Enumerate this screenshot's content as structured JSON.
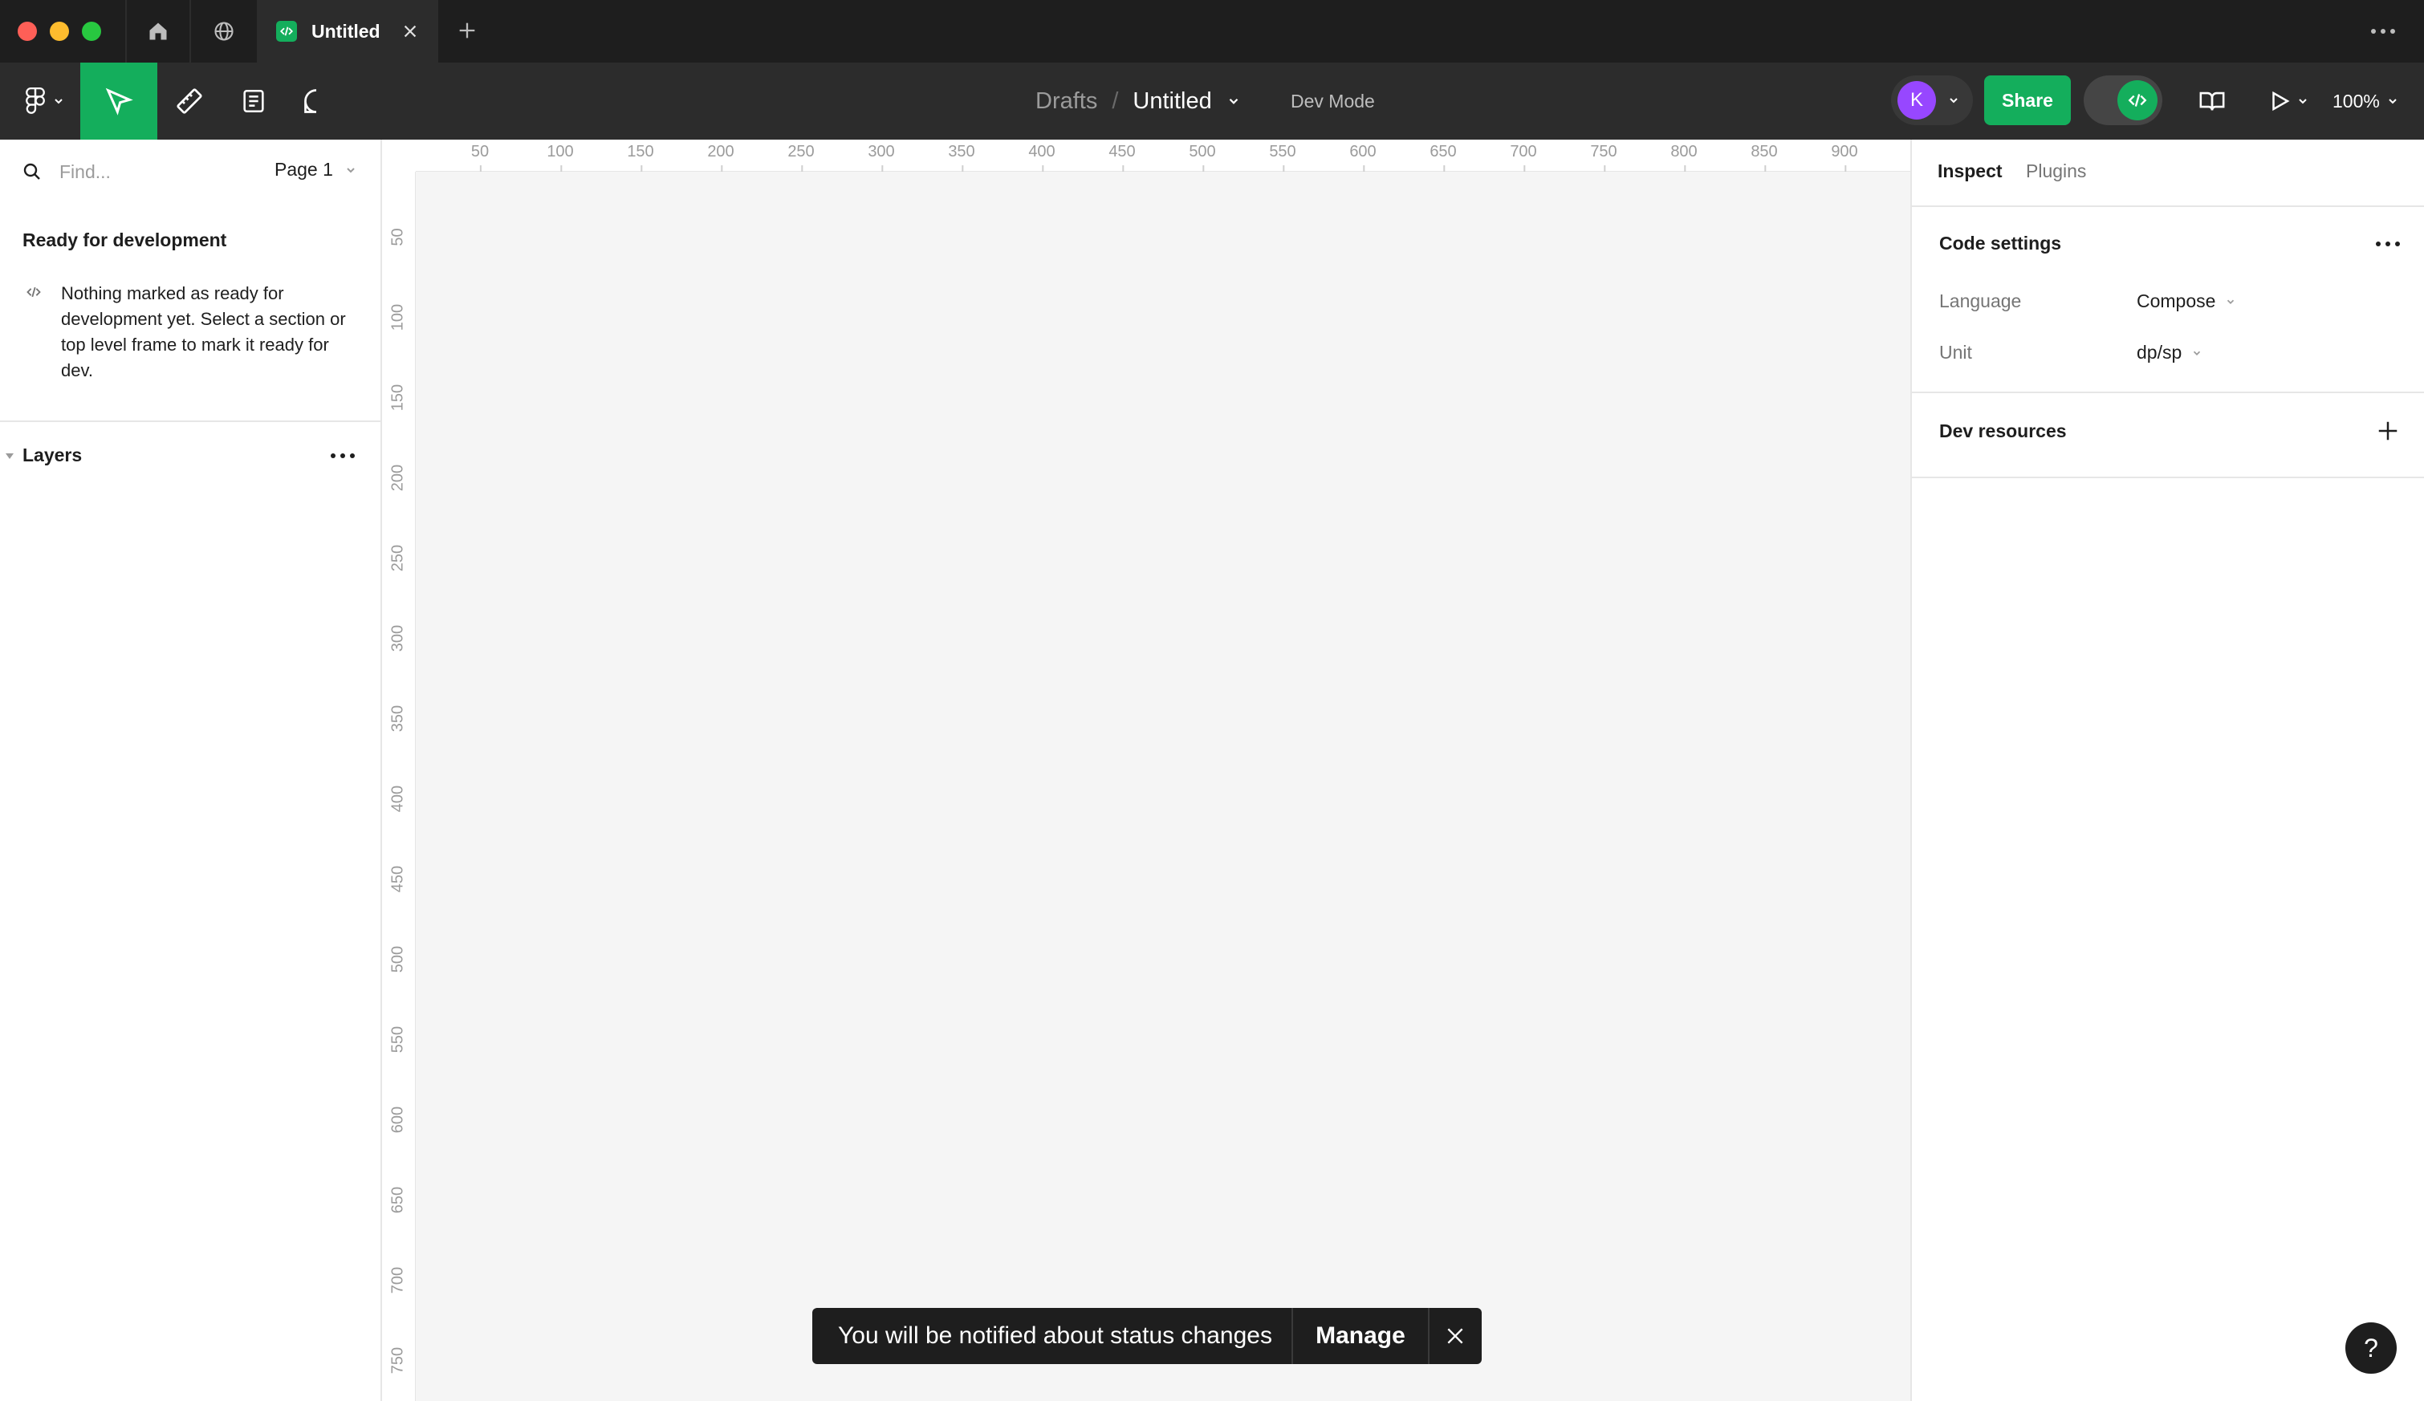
{
  "titlebar": {
    "doc_tab_label": "Untitled"
  },
  "toolbar": {
    "breadcrumb_root": "Drafts",
    "breadcrumb_sep": "/",
    "file_title": "Untitled",
    "mode_label": "Dev Mode",
    "avatar_initial": "K",
    "share_label": "Share",
    "zoom_label": "100%"
  },
  "left_panel": {
    "find_placeholder": "Find...",
    "page_label": "Page 1",
    "ready_title": "Ready for development",
    "ready_message": "Nothing marked as ready for development yet. Select a section or top level frame to mark it ready for dev.",
    "layers_label": "Layers"
  },
  "rulers": {
    "top": [
      "50",
      "100",
      "150",
      "200",
      "250",
      "300",
      "350",
      "400",
      "450",
      "500",
      "550",
      "600",
      "650",
      "700",
      "750",
      "800",
      "850",
      "900"
    ],
    "left": [
      "50",
      "100",
      "150",
      "200",
      "250",
      "300",
      "350",
      "400",
      "450",
      "500",
      "550",
      "600",
      "650",
      "700",
      "750"
    ]
  },
  "right_panel": {
    "tabs": [
      "Inspect",
      "Plugins"
    ],
    "code_settings_title": "Code settings",
    "language_label": "Language",
    "language_value": "Compose",
    "unit_label": "Unit",
    "unit_value": "dp/sp",
    "dev_resources_title": "Dev resources"
  },
  "toast": {
    "message": "You will be notified about status changes",
    "action_label": "Manage"
  },
  "help_label": "?",
  "colors": {
    "accent_green": "#14ae5c",
    "avatar_purple": "#9747ff",
    "chrome_dark": "#1e1e1e",
    "toolbar_dark": "#2c2c2c"
  }
}
